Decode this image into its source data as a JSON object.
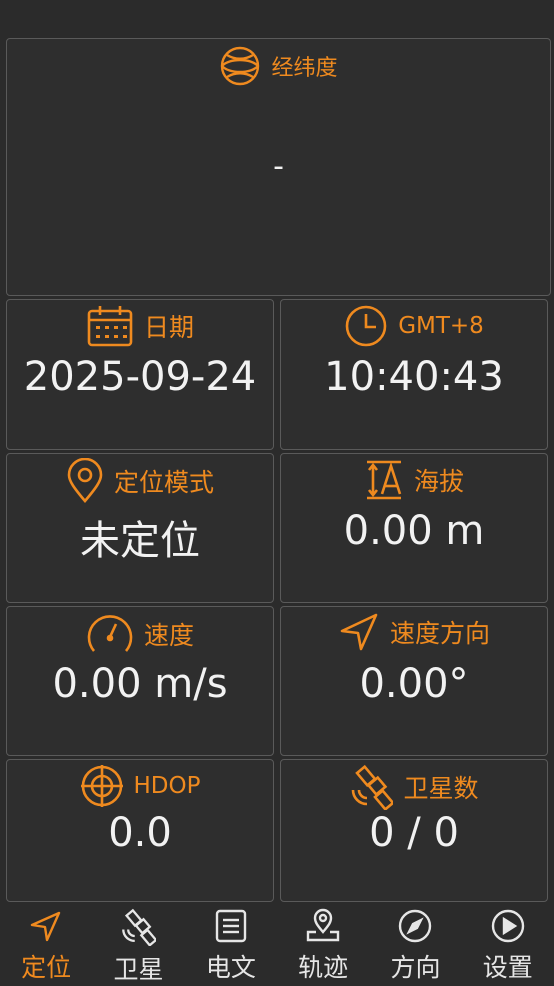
{
  "latlon": {
    "label": "经纬度",
    "value": "-"
  },
  "date": {
    "label": "日期",
    "value": "2025-09-24"
  },
  "time": {
    "label": "GMT+8",
    "value": "10:40:43"
  },
  "fix_mode": {
    "label": "定位模式",
    "value": "未定位"
  },
  "altitude": {
    "label": "海拔",
    "value": "0.00 m"
  },
  "speed": {
    "label": "速度",
    "value": "0.00 m/s"
  },
  "heading": {
    "label": "速度方向",
    "value": "0.00°"
  },
  "hdop": {
    "label": "HDOP",
    "value": "0.0"
  },
  "satellites": {
    "label": "卫星数",
    "value": "0 / 0"
  },
  "nav": [
    {
      "label": "定位",
      "icon": "navigation-arrow-icon",
      "active": true
    },
    {
      "label": "卫星",
      "icon": "satellite-icon",
      "active": false
    },
    {
      "label": "电文",
      "icon": "document-icon",
      "active": false
    },
    {
      "label": "轨迹",
      "icon": "map-pin-icon",
      "active": false
    },
    {
      "label": "方向",
      "icon": "compass-icon",
      "active": false
    },
    {
      "label": "设置",
      "icon": "play-circle-icon",
      "active": false
    }
  ],
  "colors": {
    "accent": "#ef8a1f",
    "background": "#2b2b2b",
    "border": "#5a5a5a"
  }
}
